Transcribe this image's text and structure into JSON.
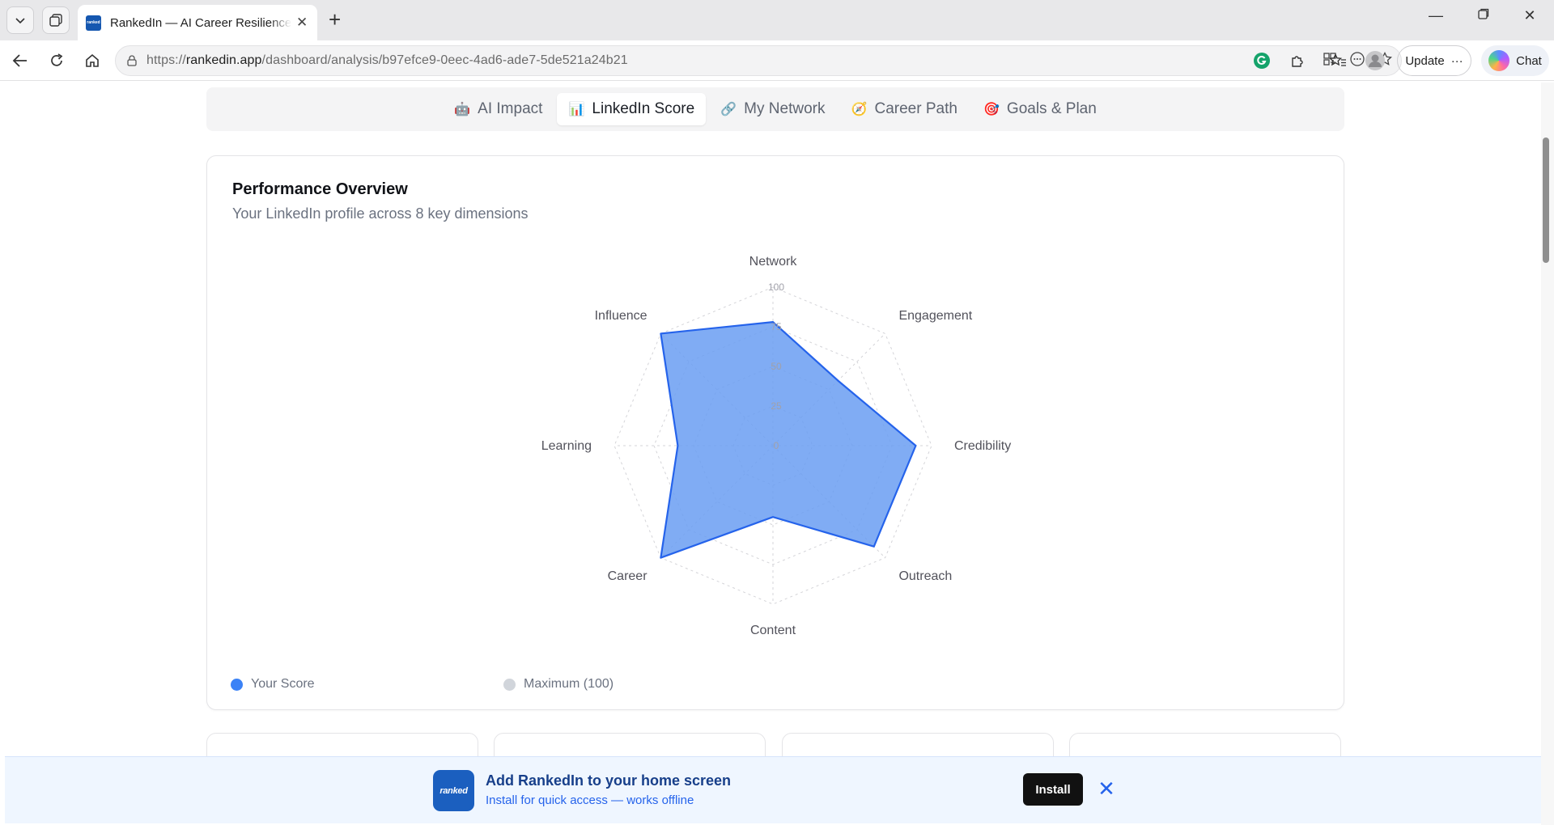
{
  "browser": {
    "tab_title": "RankedIn — AI Career Resilience Score",
    "tab_favicon_text": "ranked",
    "url_prefix": "https://",
    "url_host": "rankedin.app",
    "url_path": "/dashboard/analysis/b97efce9-0eec-4ad6-ade7-5de521a24b21",
    "update_label": "Update",
    "chat_label": "Chat"
  },
  "tabs": [
    {
      "label": "AI Impact",
      "icon": "🤖",
      "active": false
    },
    {
      "label": "LinkedIn Score",
      "icon": "📊",
      "active": true
    },
    {
      "label": "My Network",
      "icon": "🔗",
      "active": false
    },
    {
      "label": "Career Path",
      "icon": "🧭",
      "active": false
    },
    {
      "label": "Goals & Plan",
      "icon": "🎯",
      "active": false
    }
  ],
  "overview": {
    "title": "Performance Overview",
    "subtitle": "Your LinkedIn profile across 8 key dimensions"
  },
  "chart_data": {
    "type": "radar",
    "categories": [
      "Network",
      "Engagement",
      "Credibility",
      "Outreach",
      "Content",
      "Career",
      "Learning",
      "Influence"
    ],
    "series": [
      {
        "name": "Your Score",
        "values": [
          78,
          58,
          90,
          90,
          45,
          100,
          60,
          100
        ],
        "color": "#2563eb"
      },
      {
        "name": "Maximum (100)",
        "values": [
          100,
          100,
          100,
          100,
          100,
          100,
          100,
          100
        ],
        "color": "#d1d5db"
      }
    ],
    "rlim": [
      0,
      100
    ],
    "rticks": [
      "0",
      "25",
      "50",
      "75",
      "100"
    ],
    "grid": true
  },
  "legend": [
    {
      "label": "Your Score",
      "color": "#3b82f6"
    },
    {
      "label": "Maximum (100)",
      "color": "#d1d5db"
    }
  ],
  "banner": {
    "logo_text": "ranked",
    "title": "Add RankedIn to your home screen",
    "subtitle": "Install for quick access — works offline",
    "install_label": "Install"
  }
}
